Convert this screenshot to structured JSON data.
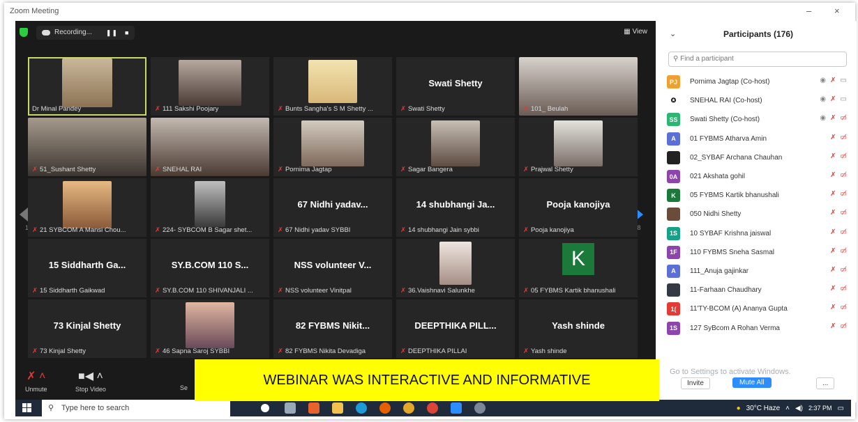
{
  "window": {
    "title": "Zoom Meeting"
  },
  "topbar": {
    "recording_label": "Recording...",
    "view_label": "View"
  },
  "tiles": [
    [
      "Dr Minal Pandey",
      "111 Sakshi Poojary",
      "Bunts Sangha's S M Shetty ...",
      "Swati Shetty",
      "101_ Beulah"
    ],
    [
      "51_Sushant Shetty",
      "SNEHAL RAI",
      "Pornima Jagtap",
      "Sagar Bangera",
      "Prajwal Shetty"
    ],
    [
      "21 SYBCOM A Mansi Chou...",
      "224- SYBCOM B Sagar shet...",
      "67 Nidhi yadav SYBBI",
      "14 shubhangi Jain sybbi",
      "Pooja kanojiya"
    ],
    [
      "15 Siddharth Gaikwad",
      "SY.B.COM 110 SHIVANJALI ...",
      "NSS volunteer Vinitpal",
      "36.Vaishnavi Salunkhe",
      "05 FYBMS Kartik bhanushali"
    ],
    [
      "73 Kinjal Shetty",
      "46 Sapna Saroj SYBBI",
      "82 FYBMS Nikita Devadiga",
      "DEEPTHIKA PILLAI",
      "Yash shinde"
    ]
  ],
  "big_names": {
    "swati": "Swati Shetty",
    "nidhi": "67 Nidhi yadav...",
    "shubhangi": "14 shubhangi Ja...",
    "pooja": "Pooja kanojiya",
    "siddharth": "15 Siddharth Ga...",
    "sybcom": "SY.B.COM 110 S...",
    "nss": "NSS volunteer V...",
    "kinjal": "73 Kinjal Shetty",
    "nikita": "82 FYBMS Nikit...",
    "deepthika": "DEEPTHIKA PILL...",
    "yash": "Yash shinde",
    "k_letter": "K"
  },
  "pages": {
    "left": "1/8",
    "right": "1/8"
  },
  "toolbar": {
    "unmute": "Unmute",
    "stop_video": "Stop Video",
    "security": "Se"
  },
  "banner": "WEBINAR WAS INTERACTIVE AND INFORMATIVE",
  "participants": {
    "title": "Participants (176)",
    "search_placeholder": "Find a participant",
    "list": [
      {
        "initials": "PJ",
        "color": "#f0a030",
        "name": "Pornima Jagtap (Co-host)"
      },
      {
        "initials": "",
        "color": "#ffffff",
        "name": "SNEHAL RAI (Co-host)"
      },
      {
        "initials": "SS",
        "color": "#2bb673",
        "name": "Swati Shetty (Co-host)"
      },
      {
        "initials": "A",
        "color": "#5b6fd6",
        "name": "01 FYBMS Atharva Amin"
      },
      {
        "initials": "",
        "color": "#222222",
        "name": "02_SYBAF Archana Chauhan"
      },
      {
        "initials": "0A",
        "color": "#8e44ad",
        "name": "021 Akshata gohil"
      },
      {
        "initials": "K",
        "color": "#1b7a3a",
        "name": "05 FYBMS Kartik bhanushali"
      },
      {
        "initials": "",
        "color": "#6b4b3a",
        "name": "050 Nidhi Shetty"
      },
      {
        "initials": "1S",
        "color": "#16a085",
        "name": "10 SYBAF Krishna jaiswal"
      },
      {
        "initials": "1F",
        "color": "#8e44ad",
        "name": "110 FYBMS Sneha Sasmal"
      },
      {
        "initials": "A",
        "color": "#5b6fd6",
        "name": "111_Anuja gajinkar"
      },
      {
        "initials": "",
        "color": "#333a44",
        "name": "11-Farhaan Chaudhary"
      },
      {
        "initials": "1(",
        "color": "#e53935",
        "name": "11'TY-BCOM (A) Ananya Gupta"
      },
      {
        "initials": "1S",
        "color": "#8e44ad",
        "name": "127 SyBcom A Rohan Verma"
      }
    ],
    "invite": "Invite",
    "mute_all": "Mute All",
    "more": "...",
    "activate_watermark": "Go to Settings to activate Windows."
  },
  "taskbar": {
    "search_placeholder": "Type here to search",
    "weather": "30°C Haze",
    "time": "2:37 PM"
  },
  "colors": {
    "accent": "#2d8cff",
    "banner_bg": "#ffff00",
    "muted_red": "#e53935",
    "active_border": "#c8d96a"
  }
}
